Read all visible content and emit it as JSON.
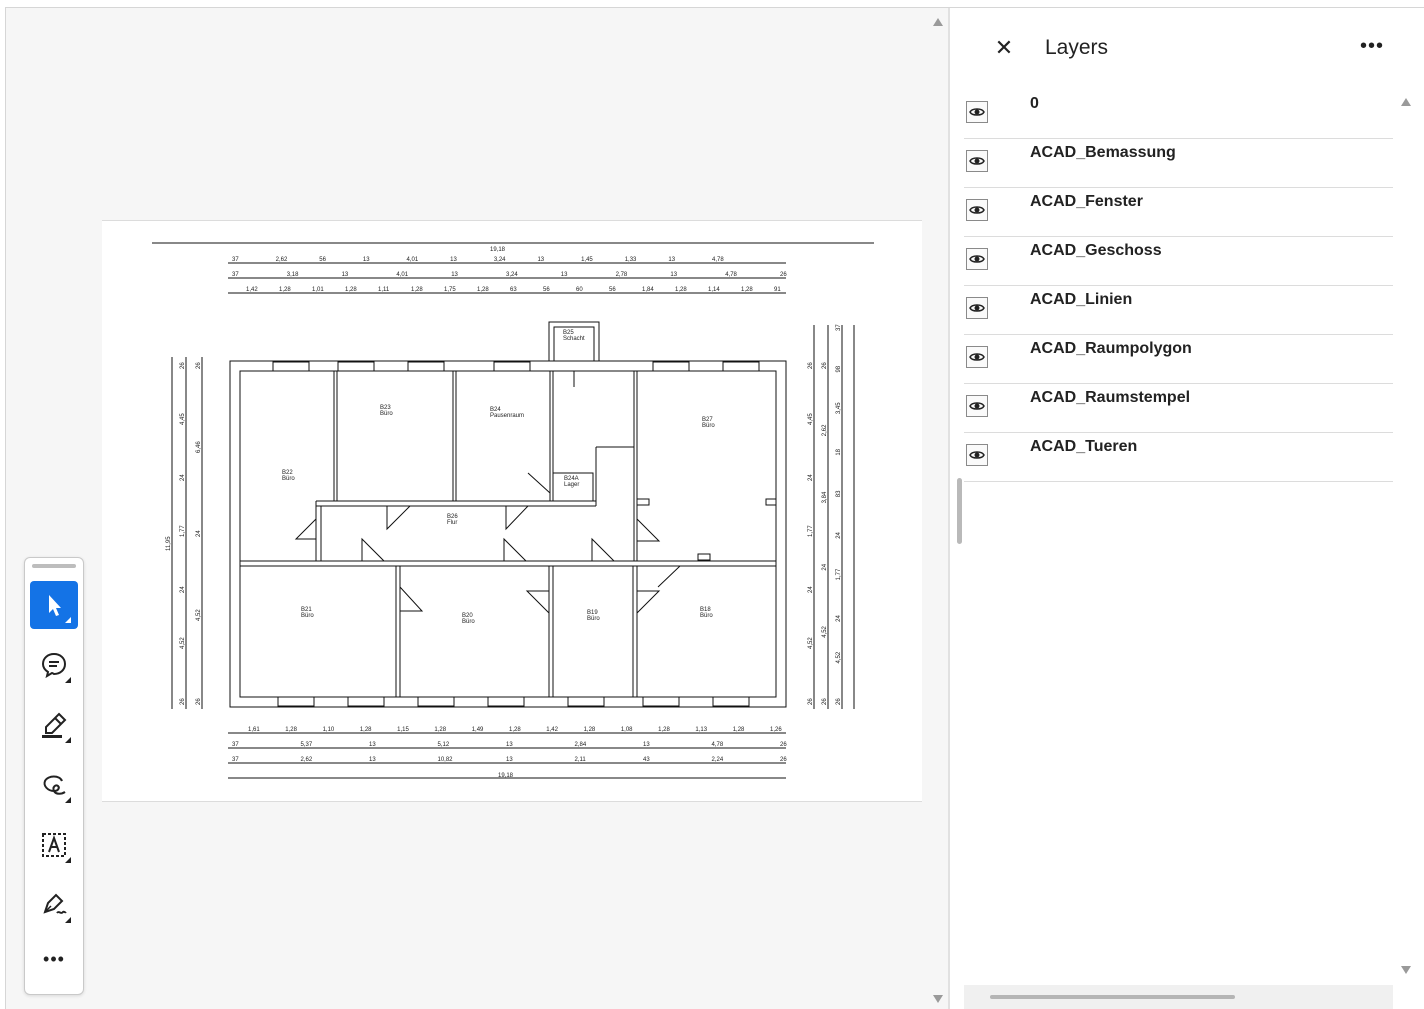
{
  "panel": {
    "title": "Layers",
    "close_icon": "close-icon",
    "more_icon": "more-options-icon",
    "more_label": "•••",
    "layers": [
      {
        "name": "0",
        "visible": true
      },
      {
        "name": "ACAD_Bemassung",
        "visible": true
      },
      {
        "name": "ACAD_Fenster",
        "visible": true
      },
      {
        "name": "ACAD_Geschoss",
        "visible": true
      },
      {
        "name": "ACAD_Linien",
        "visible": true
      },
      {
        "name": "ACAD_Raumpolygon",
        "visible": true
      },
      {
        "name": "ACAD_Raumstempel",
        "visible": true
      },
      {
        "name": "ACAD_Tueren",
        "visible": true
      }
    ]
  },
  "toolbar": {
    "tools": [
      {
        "name": "select-tool",
        "icon": "cursor-arrow-icon",
        "active": true
      },
      {
        "name": "comment-tool",
        "icon": "comment-bubble-icon",
        "active": false
      },
      {
        "name": "highlight-tool",
        "icon": "highlighter-pen-icon",
        "active": false
      },
      {
        "name": "draw-tool",
        "icon": "freehand-loop-icon",
        "active": false
      },
      {
        "name": "text-tool",
        "icon": "text-box-icon",
        "active": false
      },
      {
        "name": "sign-tool",
        "icon": "signature-pen-icon",
        "active": false
      }
    ],
    "more_label": "•••"
  },
  "drawing": {
    "overall_width": "19,18",
    "overall_height": "11,95",
    "top_dims_row1": [
      "37",
      "2,62",
      "56",
      "13",
      "4,01",
      "13",
      "3,24",
      "13",
      "1,45",
      "1,33",
      "13",
      "4,78"
    ],
    "top_dims_row2": [
      "37",
      "3,18",
      "13",
      "4,01",
      "13",
      "3,24",
      "13",
      "2,78",
      "13",
      "4,78",
      "26"
    ],
    "top_dims_row3": [
      "1,42",
      "1,28",
      "1,01",
      "1,28",
      "1,11",
      "1,28",
      "1,75",
      "1,28",
      "63",
      "56",
      "60",
      "56",
      "1,84",
      "1,28",
      "1,14",
      "1,28",
      "91"
    ],
    "bottom_dims_row1": [
      "1,61",
      "1,28",
      "1,10",
      "1,28",
      "1,15",
      "1,28",
      "1,49",
      "1,28",
      "1,42",
      "1,28",
      "1,08",
      "1,28",
      "1,13",
      "1,28",
      "1,26"
    ],
    "bottom_dims_row2": [
      "37",
      "5,37",
      "13",
      "5,12",
      "13",
      "2,84",
      "13",
      "4,78",
      "26"
    ],
    "bottom_dims_row3": [
      "37",
      "2,62",
      "13",
      "10,82",
      "13",
      "2,11",
      "43",
      "2,24",
      "26"
    ],
    "left_dims_outer": [
      "26",
      "4,45",
      "24",
      "1,77",
      "24",
      "4,52",
      "26"
    ],
    "left_dims_inner": [
      "26",
      "6,46",
      "24",
      "4,52",
      "26"
    ],
    "right_dims_a": [
      "26",
      "4,45",
      "24",
      "1,77",
      "24",
      "4,52",
      "26"
    ],
    "right_dims_b": [
      "26",
      "2,62",
      "3,84",
      "24",
      "4,52",
      "26"
    ],
    "right_dims_c": [
      "37",
      "98",
      "3,45",
      "18",
      "83",
      "24",
      "1,77",
      "24",
      "4,52",
      "26"
    ],
    "rooms": [
      {
        "id": "B22",
        "label": "Büro"
      },
      {
        "id": "B23",
        "label": "Büro"
      },
      {
        "id": "B24",
        "label": "Pausenraum"
      },
      {
        "id": "B24A",
        "label": "Lager"
      },
      {
        "id": "B26",
        "label": "Flur"
      },
      {
        "id": "B27",
        "label": "Büro"
      },
      {
        "id": "B25",
        "label": "Schacht"
      },
      {
        "id": "B21",
        "label": "Büro"
      },
      {
        "id": "B20",
        "label": "Büro"
      },
      {
        "id": "B19",
        "label": "Büro"
      },
      {
        "id": "B18",
        "label": "Büro"
      }
    ]
  }
}
